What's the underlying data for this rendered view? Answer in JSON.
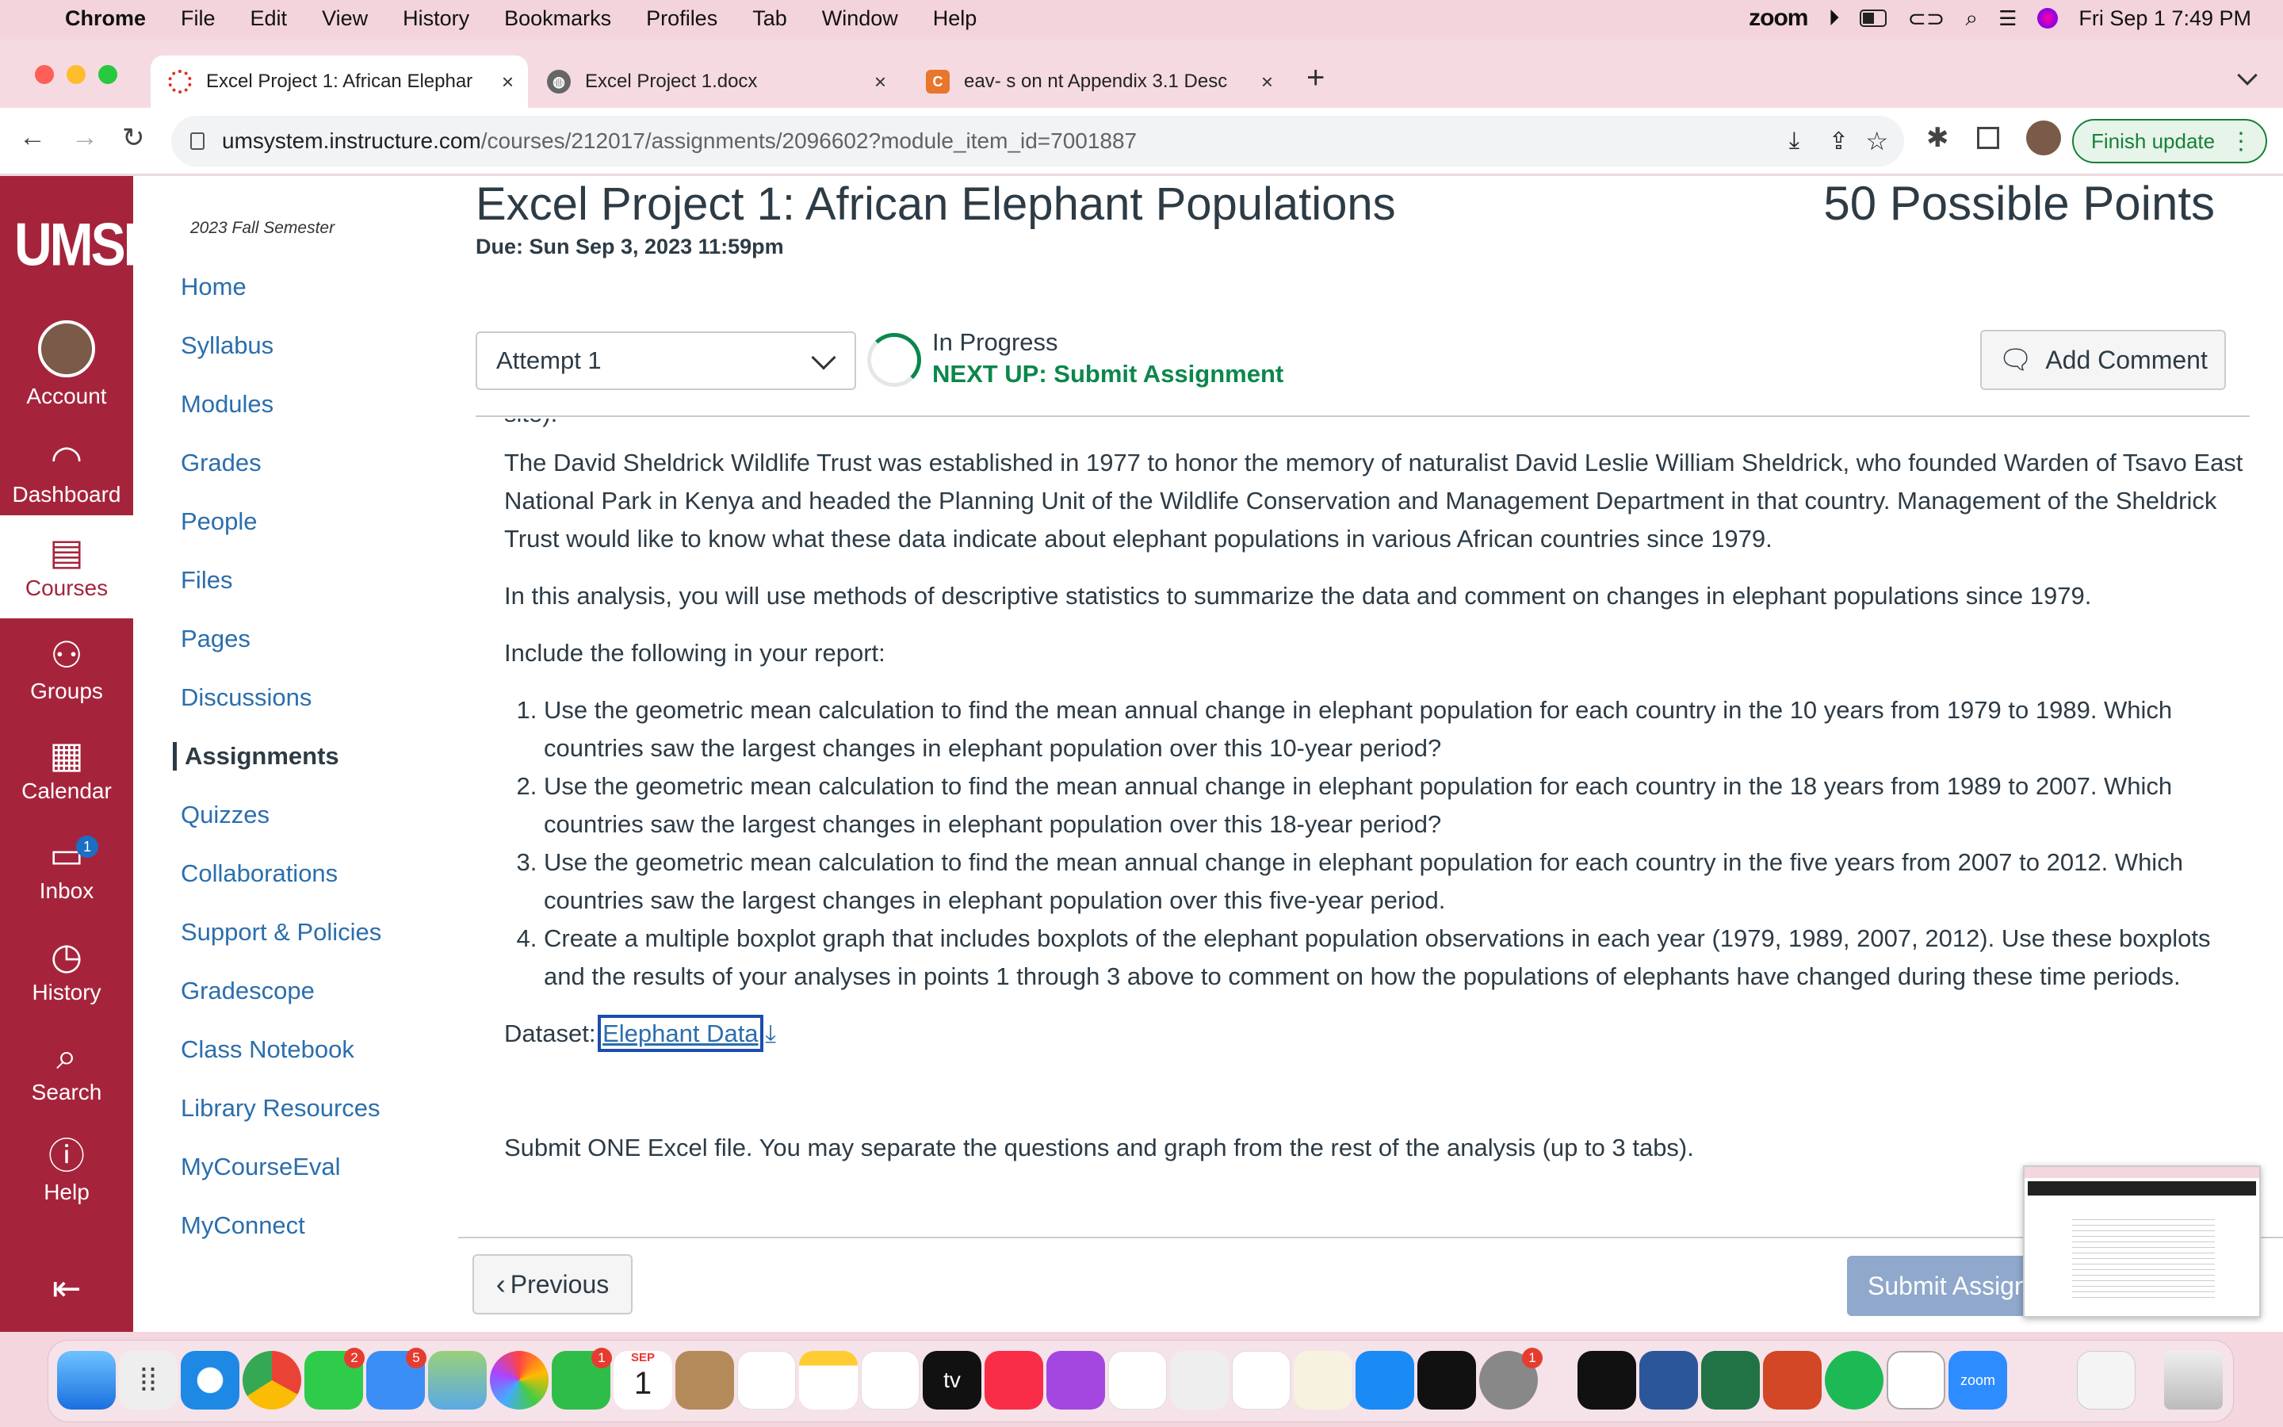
{
  "menubar": {
    "app": "Chrome",
    "menus": [
      "File",
      "Edit",
      "View",
      "History",
      "Bookmarks",
      "Profiles",
      "Tab",
      "Window",
      "Help"
    ],
    "zoom_label": "zoom",
    "clock": "Fri Sep 1  7:49 PM"
  },
  "tabs": [
    {
      "title": "Excel Project 1: African Elephar",
      "close": "×"
    },
    {
      "title": "Excel Project 1.docx",
      "close": "×"
    },
    {
      "title": "eav- s on nt Appendix 3.1 Desc",
      "close": "×"
    }
  ],
  "new_tab": "+",
  "address": {
    "domain": "umsystem.instructure.com",
    "path": "/courses/212017/assignments/2096602?module_item_id=7001887"
  },
  "finish_update": "Finish update",
  "global_nav": {
    "logo": "UMSL",
    "items": [
      {
        "label": "Account"
      },
      {
        "label": "Dashboard"
      },
      {
        "label": "Courses"
      },
      {
        "label": "Groups"
      },
      {
        "label": "Calendar"
      },
      {
        "label": "Inbox",
        "badge": "1"
      },
      {
        "label": "History"
      },
      {
        "label": "Search"
      },
      {
        "label": "Help"
      }
    ]
  },
  "course_nav": {
    "semester": "2023 Fall Semester",
    "items": [
      "Home",
      "Syllabus",
      "Modules",
      "Grades",
      "People",
      "Files",
      "Pages",
      "Discussions",
      "Assignments",
      "Quizzes",
      "Collaborations",
      "Support & Policies",
      "Gradescope",
      "Class Notebook",
      "Library Resources",
      "MyCourseEval",
      "MyConnect"
    ],
    "active": "Assignments"
  },
  "assignment": {
    "title": "Excel Project 1: African Elephant Populations",
    "due": "Due: Sun Sep 3, 2023 11:59pm",
    "points": "50 Possible Points",
    "attempt": "Attempt 1",
    "status": "In Progress",
    "next_up": "NEXT UP: Submit Assignment",
    "add_comment": "Add Comment",
    "cut_text": "site).",
    "paragraphs": [
      "The David Sheldrick Wildlife Trust was established in 1977 to honor the memory of naturalist David Leslie William Sheldrick, who founded Warden of Tsavo East National Park in Kenya and headed the Planning Unit of the Wildlife Conservation and Management Department in that country. Management of the Sheldrick Trust would like to know what these data indicate about elephant populations in various African countries since 1979.",
      "In this analysis, you will use methods of descriptive statistics to summarize the data and comment on changes in elephant populations since 1979.",
      "Include the following in your report:"
    ],
    "list": [
      "Use the geometric mean calculation to find the mean annual change in elephant population for each country in the 10 years from 1979 to 1989. Which countries saw the largest changes in elephant population over this 10-year period?",
      "Use the geometric mean calculation to find the mean annual change in elephant population for each country in the 18 years from 1989 to 2007. Which countries saw the largest changes in elephant population over this 18-year period?",
      "Use the geometric mean calculation to find the mean annual change in elephant population for each country in the five years from 2007 to 2012. Which countries saw the largest changes in elephant population over this five-year period.",
      "Create a multiple boxplot graph that includes boxplots of the elephant population observations in each year (1979, 1989, 2007, 2012). Use these boxplots and the results of your analyses in points 1 through 3 above to comment on how the populations of elephants have changed during these time periods."
    ],
    "dataset_label": "Dataset:",
    "dataset_link": "Elephant Data",
    "submit_note": "Submit ONE Excel file. You may separate the questions and graph from the rest of the analysis (up to 3 tabs)."
  },
  "footer": {
    "previous": "Previous",
    "submit": "Submit Assignment"
  },
  "dock": {
    "calendar_month": "SEP",
    "calendar_day": "1",
    "tv_label": "tv",
    "zoom_label": "zoom",
    "badges": [
      "2",
      "5",
      "1",
      "1"
    ]
  },
  "colors": {
    "canvas_red": "#a5243c",
    "link": "#2b6ead",
    "green": "#0b874b"
  }
}
